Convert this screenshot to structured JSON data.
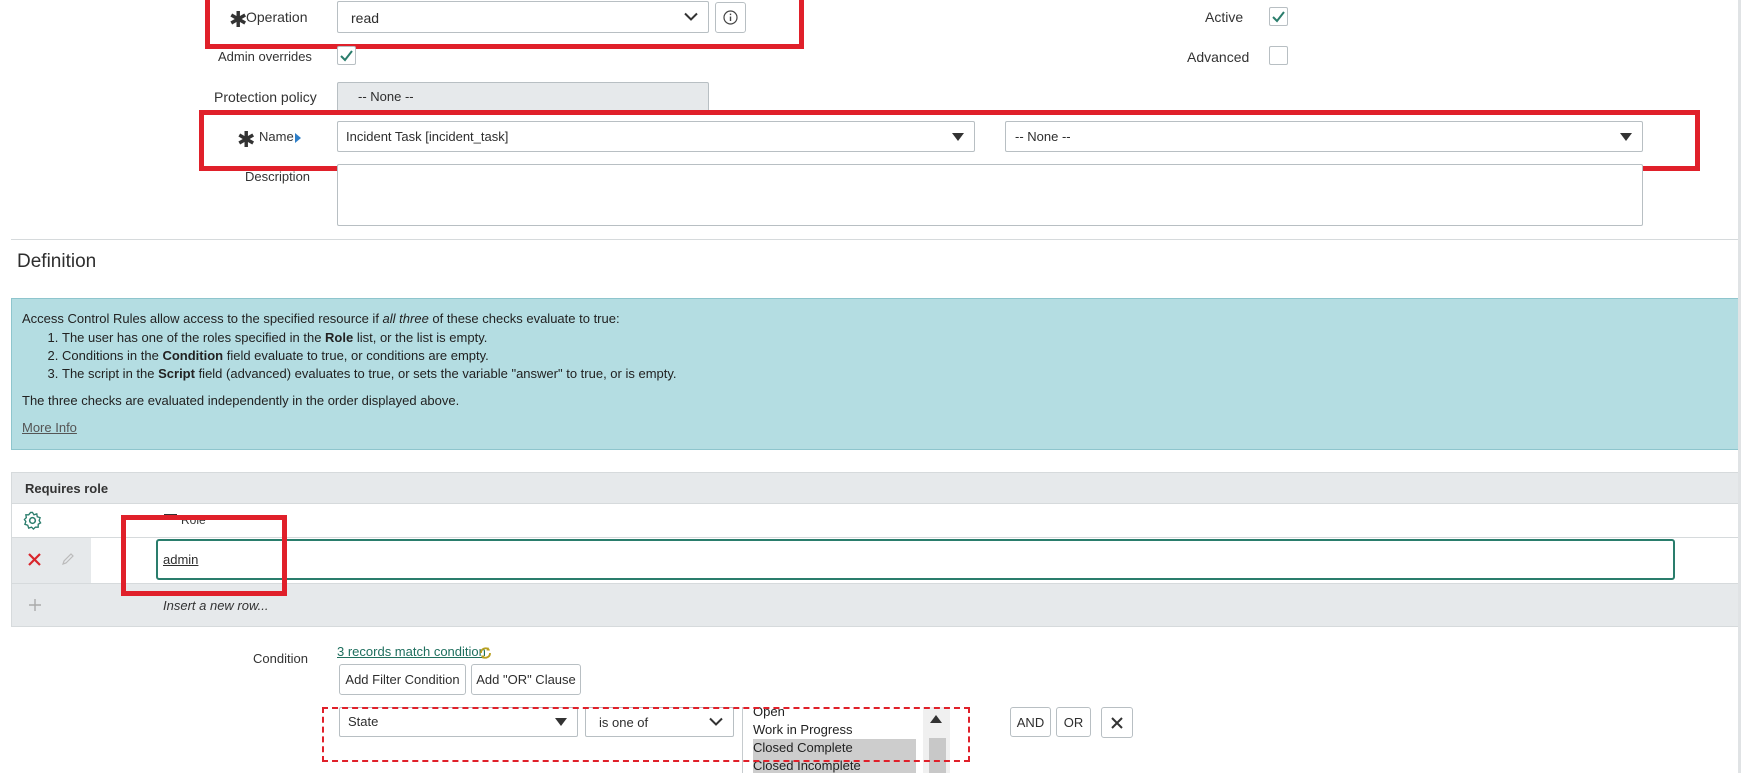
{
  "form": {
    "operation_label": "Operation",
    "operation_value": "read",
    "active_label": "Active",
    "admin_overrides_label": "Admin overrides",
    "advanced_label": "Advanced",
    "protection_policy_label": "Protection policy",
    "protection_policy_value": "-- None --",
    "name_label": "Name",
    "name_value": "Incident Task [incident_task]",
    "field_value": "-- None --",
    "description_label": "Description",
    "description_value": ""
  },
  "definition": {
    "heading": "Definition",
    "intro_pre": "Access Control Rules allow access to the specified resource if ",
    "intro_em": "all three",
    "intro_post": " of these checks evaluate to true:",
    "items": [
      {
        "pre": "The user has one of the roles specified in the ",
        "bold": "Role",
        "post": " list, or the list is empty."
      },
      {
        "pre": "Conditions in the ",
        "bold": "Condition",
        "post": " field evaluate to true, or conditions are empty."
      },
      {
        "pre": "The script in the ",
        "bold": "Script",
        "post": " field (advanced) evaluates to true, or sets the variable \"answer\" to true, or is empty."
      }
    ],
    "footer": "The three checks are evaluated independently in the order displayed above.",
    "more_info": "More Info"
  },
  "requires_role": {
    "title": "Requires role",
    "column": "Role",
    "row_value": "admin",
    "insert_row": "Insert a new row..."
  },
  "condition": {
    "label": "Condition",
    "records_link": "3 records match condition",
    "add_filter": "Add Filter Condition",
    "add_or": "Add \"OR\" Clause",
    "field": "State",
    "operator": "is one of",
    "options": [
      "Open",
      "Work in Progress",
      "Closed Complete",
      "Closed Incomplete"
    ],
    "and_label": "AND",
    "or_label": "OR"
  },
  "colors": {
    "highlight": "#e0202a",
    "info_bg": "#b4dde2",
    "link": "#1f6f5e"
  }
}
